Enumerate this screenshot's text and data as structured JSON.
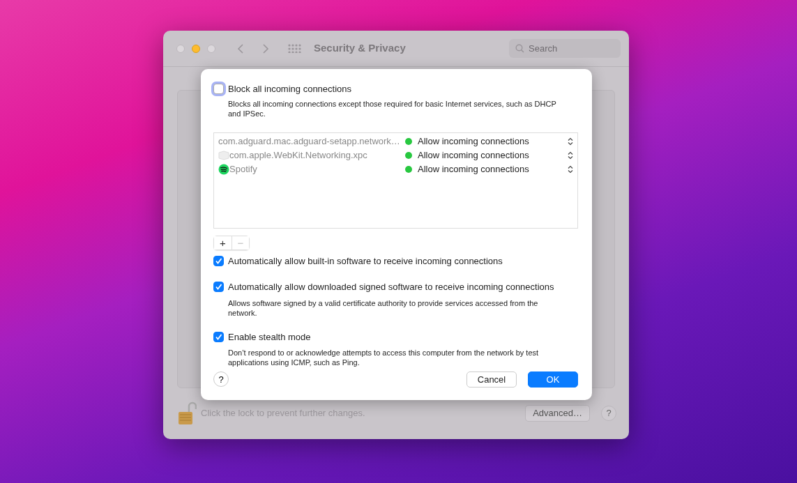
{
  "window": {
    "title": "Security & Privacy",
    "search": {
      "placeholder": "Search"
    },
    "lock_text": "Click the lock to prevent further changes.",
    "advanced_button": "Advanced…",
    "help_button": "?"
  },
  "dialog": {
    "block_all": {
      "label": "Block all incoming connections",
      "checked": false,
      "description": "Blocks all incoming connections except those required for basic Internet services, such as DHCP and IPSec."
    },
    "apps": [
      {
        "name": "com.adguard.mac.adguard-setapp.network…",
        "kind": "plain",
        "status": "Allow incoming connections",
        "color": "#28c840"
      },
      {
        "name": "com.apple.WebKit.Networking.xpc",
        "kind": "generic",
        "status": "Allow incoming connections",
        "color": "#28c840"
      },
      {
        "name": "Spotify",
        "kind": "spotify",
        "status": "Allow incoming connections",
        "color": "#28c840"
      }
    ],
    "add_button": "+",
    "remove_button": "−",
    "options": [
      {
        "label": "Automatically allow built-in software to receive incoming connections",
        "checked": true
      },
      {
        "label": "Automatically allow downloaded signed software to receive incoming connections",
        "checked": true,
        "description": "Allows software signed by a valid certificate authority to provide services accessed from the network."
      },
      {
        "label": "Enable stealth mode",
        "checked": true,
        "description": "Don’t respond to or acknowledge attempts to access this computer from the network by test applications using ICMP, such as Ping."
      }
    ],
    "help_button": "?",
    "cancel_button": "Cancel",
    "ok_button": "OK"
  }
}
